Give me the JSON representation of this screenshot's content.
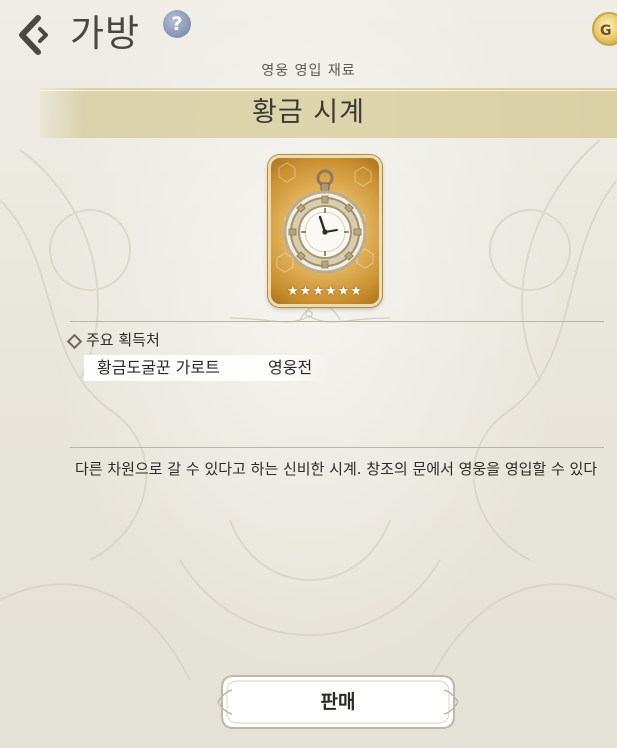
{
  "header": {
    "title": "가방",
    "help_icon_label": "?",
    "currency_icon_label": "G"
  },
  "item": {
    "category": "영웅 영입 재료",
    "name": "황금 시계",
    "stars": "★★★★★★",
    "icon": "golden-pocket-watch"
  },
  "acquisition": {
    "title": "주요 획득처",
    "sources": [
      "황금도굴꾼 가로트",
      "영웅전"
    ]
  },
  "description": "다른 차원으로 갈 수 있다고 하는 신비한 시계. 창조의 문에서 영웅을 영입할 수 있다",
  "actions": {
    "sell_label": "판매"
  },
  "colors": {
    "banner": "#ddd5ab",
    "card_gold": "#e5b862",
    "help_blue": "#8492b3",
    "text": "#2d2b27"
  }
}
